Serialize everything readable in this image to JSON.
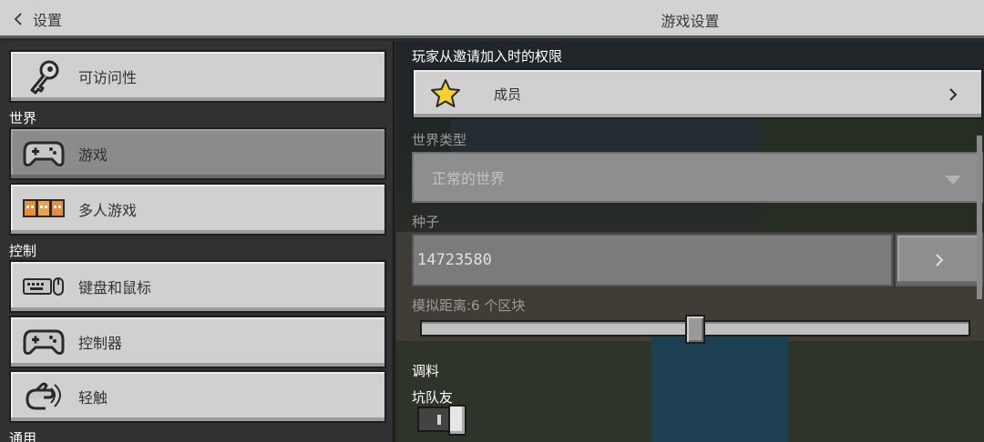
{
  "header": {
    "back_label": "设置",
    "title": "游戏设置"
  },
  "sidebar": {
    "items": [
      {
        "label": "可访问性",
        "icon": "key-icon",
        "selected": false
      },
      {
        "label": "游戏",
        "icon": "gamepad-icon",
        "selected": true
      },
      {
        "label": "多人游戏",
        "icon": "players-icon",
        "selected": false
      },
      {
        "label": "键盘和鼠标",
        "icon": "keyboard-mouse-icon",
        "selected": false
      },
      {
        "label": "控制器",
        "icon": "controller-icon",
        "selected": false
      },
      {
        "label": "轻触",
        "icon": "touch-hand-icon",
        "selected": false
      }
    ],
    "sections": {
      "world": "世界",
      "controls": "控制",
      "general": "通用"
    }
  },
  "settings": {
    "permission": {
      "label": "玩家从邀请加入时的权限",
      "value": "成员",
      "icon": "star-icon"
    },
    "world_type": {
      "label": "世界类型",
      "value": "正常的世界",
      "disabled": true
    },
    "seed": {
      "label": "种子",
      "value": "14723580"
    },
    "simulation_distance": {
      "label": "模拟距离:6 个区块",
      "value": 6,
      "min": 4,
      "max": 12,
      "position_fraction": 0.5
    },
    "cheats": {
      "section_label": "调料",
      "toggle_label": "坑队友",
      "enabled": true
    }
  },
  "colors": {
    "button": "#d0d0d0",
    "button_selected": "#8b8b8b",
    "panel_dark": "#313131",
    "topbar": "#d2d2d2"
  }
}
